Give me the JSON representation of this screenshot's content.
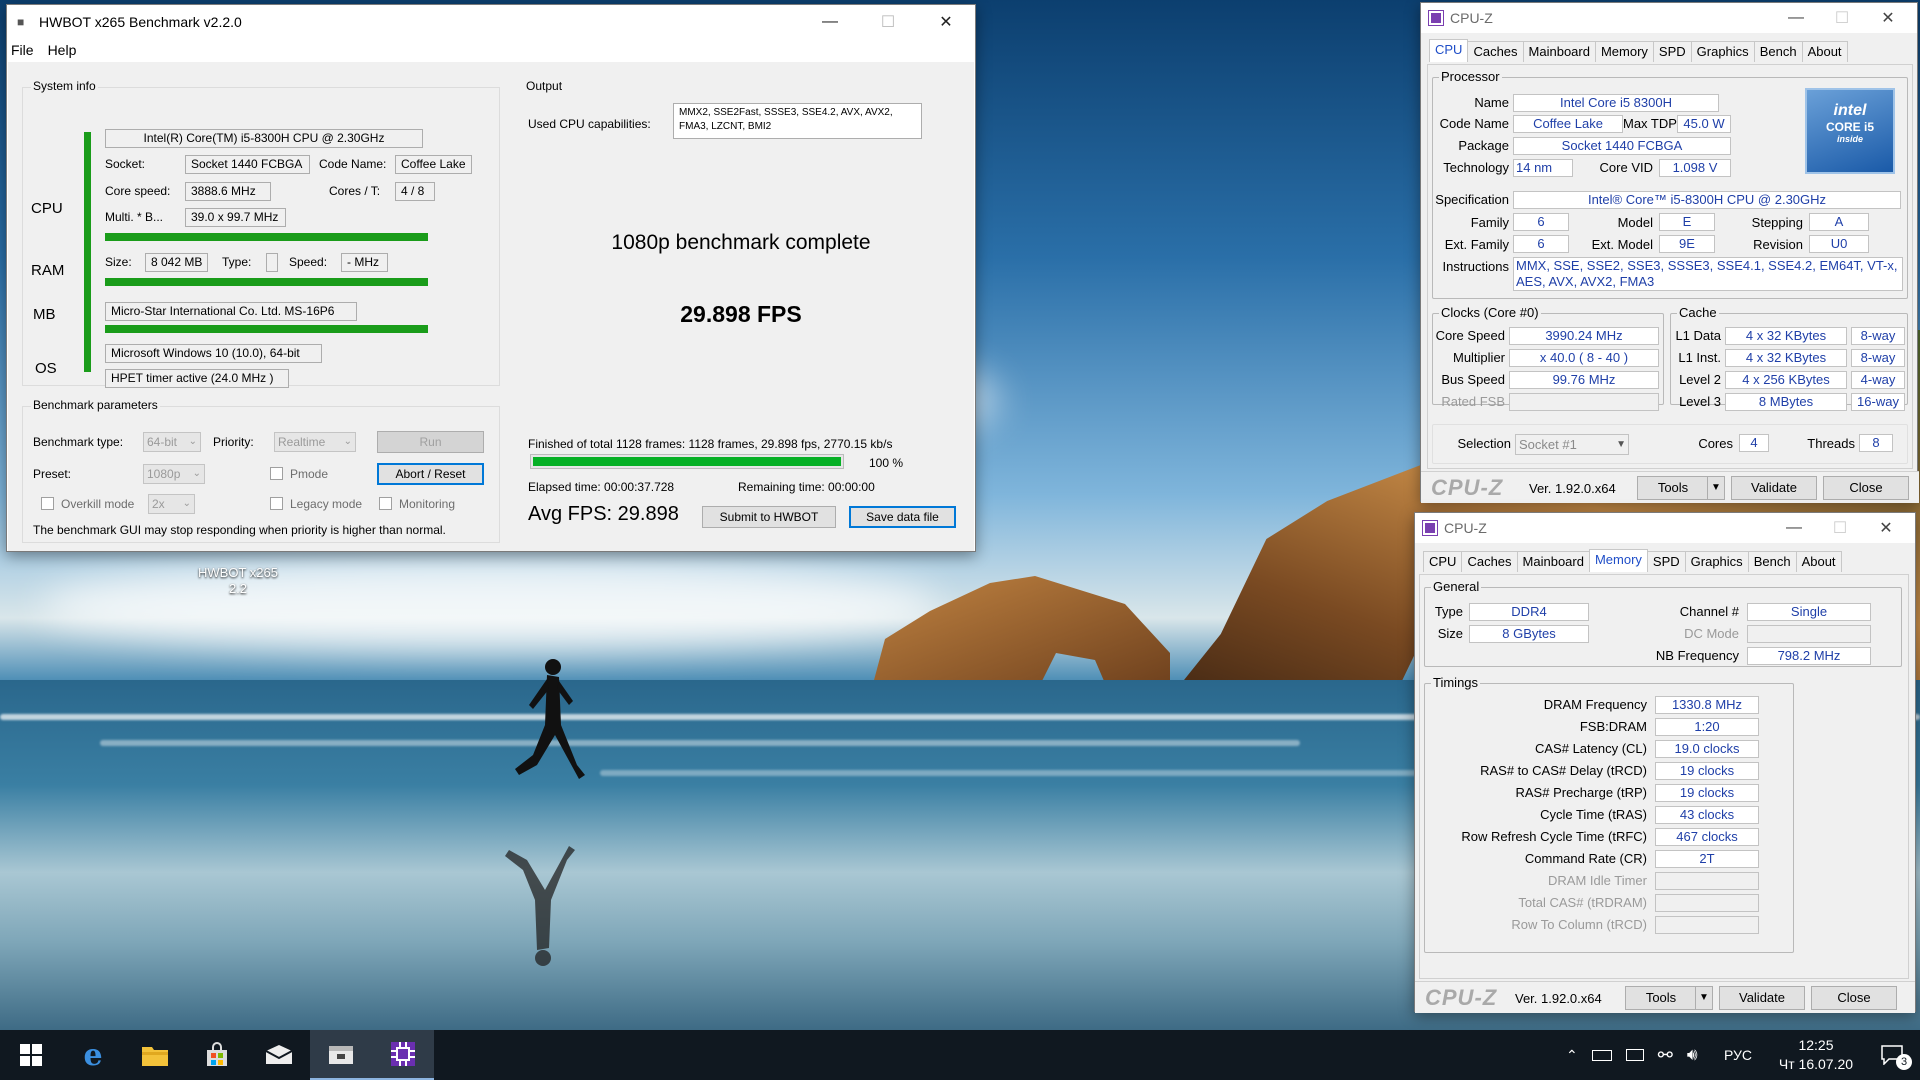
{
  "hwbot": {
    "title": "HWBOT x265 Benchmark v2.2.0",
    "menu": [
      "File",
      "Help"
    ],
    "system_info": {
      "group_title": "System info",
      "cpu_name": "Intel(R) Core(TM) i5-8300H CPU @ 2.30GHz",
      "side_labels": [
        "CPU",
        "RAM",
        "MB",
        "OS"
      ],
      "socket_label": "Socket:",
      "socket": "Socket 1440 FCBGA",
      "codename_label": "Code Name:",
      "codename": "Coffee Lake",
      "core_speed_label": "Core speed:",
      "core_speed": "3888.6 MHz",
      "cores_label": "Cores / T:",
      "cores": "4 / 8",
      "multi_label": "Multi. * B...",
      "multi": "39.0 x 99.7 MHz",
      "size_label": "Size:",
      "size": "8 042 MB",
      "type_label": "Type:",
      "type": "",
      "speed_label": "Speed:",
      "speed": "- MHz",
      "mb": "Micro-Star International Co. Ltd. MS-16P6",
      "os": "Microsoft Windows 10 (10.0), 64-bit",
      "timer": "HPET timer active (24.0 MHz )"
    },
    "benchmark_params": {
      "group_title": "Benchmark parameters",
      "type_label": "Benchmark type:",
      "type_value": "64-bit",
      "priority_label": "Priority:",
      "priority_value": "Realtime",
      "run_label": "Run",
      "preset_label": "Preset:",
      "preset_value": "1080p",
      "pmode_label": "Pmode",
      "abort_label": "Abort / Reset",
      "overkill_label": "Overkill mode",
      "overkill_value": "2x",
      "legacy_label": "Legacy mode",
      "monitoring_label": "Monitoring",
      "warning": "The benchmark GUI may stop responding when priority is higher than normal."
    },
    "output": {
      "group_title": "Output",
      "caps_label": "Used CPU capabilities:",
      "caps_value": "MMX2, SSE2Fast, SSSE3, SSE4.2, AVX, AVX2, FMA3, LZCNT, BMI2",
      "status": "1080p benchmark complete",
      "fps": "29.898 FPS",
      "finished": "Finished of total 1128 frames: 1128 frames, 29.898 fps,   2770.15 kb/s",
      "progress_percent": 100,
      "progress_label": "100 %",
      "elapsed": "Elapsed time: 00:00:37.728",
      "remaining": "Remaining time: 00:00:00",
      "avg_fps": "Avg FPS: 29.898",
      "submit_label": "Submit to HWBOT",
      "save_label": "Save data file"
    }
  },
  "desktop_icon": {
    "line1": "HWBOT x265",
    "line2": "2.2"
  },
  "cpuz_cpu": {
    "title": "CPU-Z",
    "tabs": [
      "CPU",
      "Caches",
      "Mainboard",
      "Memory",
      "SPD",
      "Graphics",
      "Bench",
      "About"
    ],
    "active_tab": "CPU",
    "processor_title": "Processor",
    "name_label": "Name",
    "name": "Intel Core i5 8300H",
    "codename_label": "Code Name",
    "codename": "Coffee Lake",
    "maxtdp_label": "Max TDP",
    "maxtdp": "45.0 W",
    "package_label": "Package",
    "package": "Socket 1440 FCBGA",
    "technology_label": "Technology",
    "technology": "14 nm",
    "corevid_label": "Core VID",
    "corevid": "1.098 V",
    "spec_label": "Specification",
    "spec": "Intel® Core™ i5-8300H CPU @ 2.30GHz",
    "family_label": "Family",
    "family": "6",
    "model_label": "Model",
    "model": "E",
    "stepping_label": "Stepping",
    "stepping": "A",
    "extfamily_label": "Ext. Family",
    "extfamily": "6",
    "extmodel_label": "Ext. Model",
    "extmodel": "9E",
    "revision_label": "Revision",
    "revision": "U0",
    "instr_label": "Instructions",
    "instr1": "MMX, SSE, SSE2, SSE3, SSSE3, SSE4.1, SSE4.2, EM64T, VT-x,",
    "instr2": "AES, AVX, AVX2, FMA3",
    "intel_logo": {
      "l1": "intel",
      "l2": "CORE i5",
      "l3": "inside"
    },
    "clocks_title": "Clocks (Core #0)",
    "corespeed_label": "Core Speed",
    "corespeed": "3990.24 MHz",
    "multiplier_label": "Multiplier",
    "multiplier": "x 40.0 ( 8 - 40 )",
    "busspeed_label": "Bus Speed",
    "busspeed": "99.76 MHz",
    "ratedfsb_label": "Rated FSB",
    "ratedfsb": "",
    "cache_title": "Cache",
    "l1d_label": "L1 Data",
    "l1d": "4 x 32 KBytes",
    "l1d_way": "8-way",
    "l1i_label": "L1 Inst.",
    "l1i": "4 x 32 KBytes",
    "l1i_way": "8-way",
    "l2_label": "Level 2",
    "l2": "4 x 256 KBytes",
    "l2_way": "4-way",
    "l3_label": "Level 3",
    "l3": "8 MBytes",
    "l3_way": "16-way",
    "selection_label": "Selection",
    "selection": "Socket #1",
    "cores_label": "Cores",
    "cores": "4",
    "threads_label": "Threads",
    "threads": "8",
    "logo": "CPU-Z",
    "version": "Ver. 1.92.0.x64",
    "tools": "Tools",
    "validate": "Validate",
    "close": "Close"
  },
  "cpuz_mem": {
    "title": "CPU-Z",
    "tabs": [
      "CPU",
      "Caches",
      "Mainboard",
      "Memory",
      "SPD",
      "Graphics",
      "Bench",
      "About"
    ],
    "active_tab": "Memory",
    "general_title": "General",
    "type_label": "Type",
    "type": "DDR4",
    "size_label": "Size",
    "size": "8 GBytes",
    "channel_label": "Channel #",
    "channel": "Single",
    "dcmode_label": "DC Mode",
    "dcmode": "",
    "nbfreq_label": "NB Frequency",
    "nbfreq": "798.2 MHz",
    "timings_title": "Timings",
    "timings": [
      {
        "label": "DRAM Frequency",
        "value": "1330.8 MHz",
        "dim": false
      },
      {
        "label": "FSB:DRAM",
        "value": "1:20",
        "dim": false
      },
      {
        "label": "CAS# Latency (CL)",
        "value": "19.0 clocks",
        "dim": false
      },
      {
        "label": "RAS# to CAS# Delay (tRCD)",
        "value": "19 clocks",
        "dim": false
      },
      {
        "label": "RAS# Precharge (tRP)",
        "value": "19 clocks",
        "dim": false
      },
      {
        "label": "Cycle Time (tRAS)",
        "value": "43 clocks",
        "dim": false
      },
      {
        "label": "Row Refresh Cycle Time (tRFC)",
        "value": "467 clocks",
        "dim": false
      },
      {
        "label": "Command Rate (CR)",
        "value": "2T",
        "dim": false
      },
      {
        "label": "DRAM Idle Timer",
        "value": "",
        "dim": true
      },
      {
        "label": "Total CAS# (tRDRAM)",
        "value": "",
        "dim": true
      },
      {
        "label": "Row To Column (tRCD)",
        "value": "",
        "dim": true
      }
    ],
    "logo": "CPU-Z",
    "version": "Ver. 1.92.0.x64",
    "tools": "Tools",
    "validate": "Validate",
    "close": "Close"
  },
  "taskbar": {
    "lang": "РУС",
    "time": "12:25",
    "date": "Чт 16.07.20",
    "notification_count": "3"
  }
}
